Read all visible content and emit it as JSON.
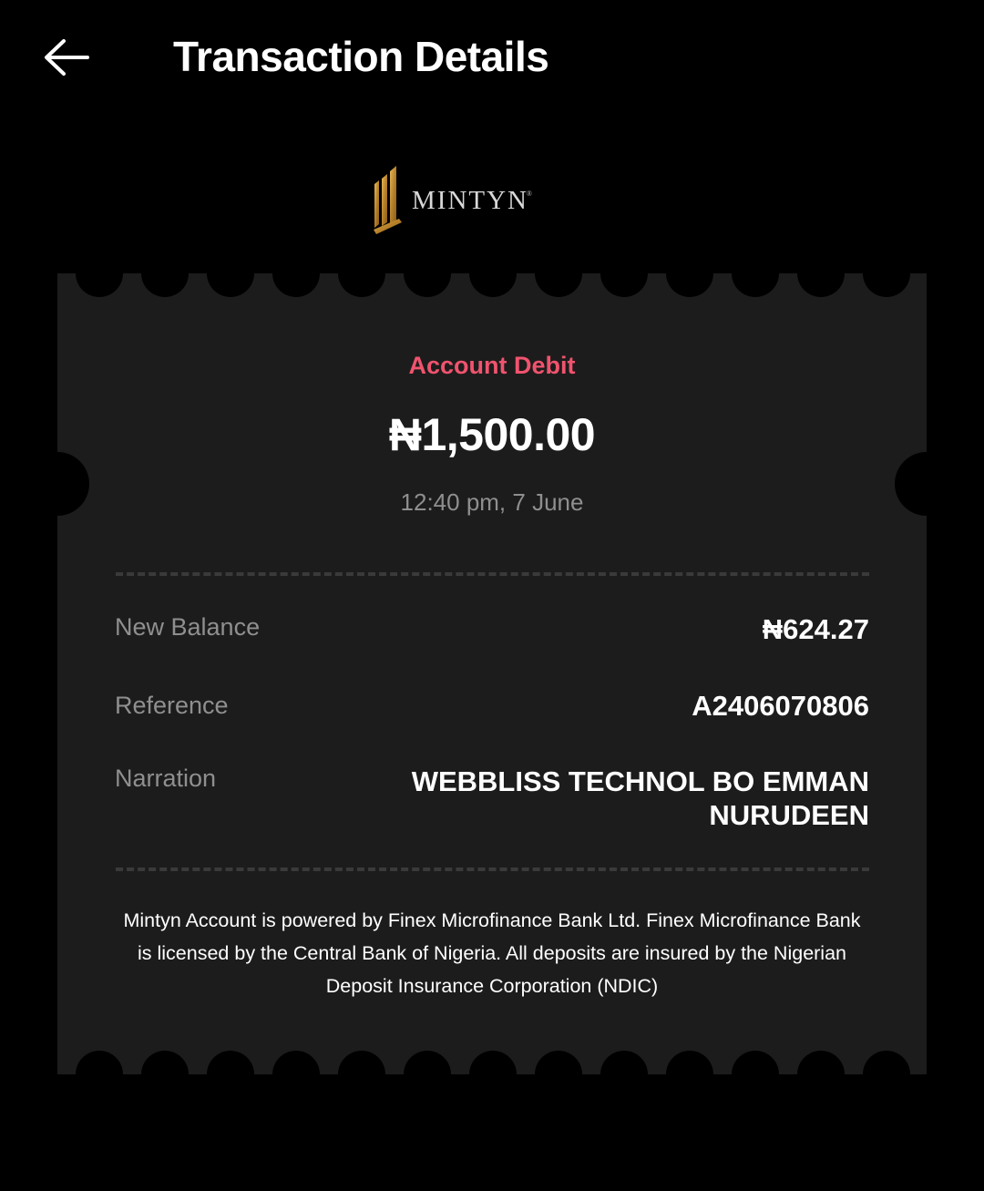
{
  "header": {
    "back_icon": "arrow-left-icon",
    "title": "Transaction Details"
  },
  "logo": {
    "text": "MINTYN",
    "registered_mark": "®",
    "colors": {
      "mark_gold": "#c9962f",
      "text": "#d8d8d8"
    }
  },
  "transaction": {
    "type_label": "Account Debit",
    "amount": "₦1,500.00",
    "datetime": "12:40 pm, 7 June"
  },
  "details": [
    {
      "label": "New Balance",
      "value": "₦624.27"
    },
    {
      "label": "Reference",
      "value": "A2406070806"
    },
    {
      "label": "Narration",
      "value": "WEBBLISS TECHNOL BO EMMAN NURUDEEN"
    }
  ],
  "footer_note": "Mintyn Account is powered by Finex Microfinance Bank Ltd. Finex Microfinance Bank is licensed by the Central Bank of Nigeria. All deposits are insured by the Nigerian Deposit Insurance Corporation (NDIC)",
  "colors": {
    "background": "#000000",
    "card": "#1c1c1c",
    "debit_accent": "#f0536e",
    "muted_text": "#8f8f8f",
    "divider": "#3a3a3a"
  }
}
